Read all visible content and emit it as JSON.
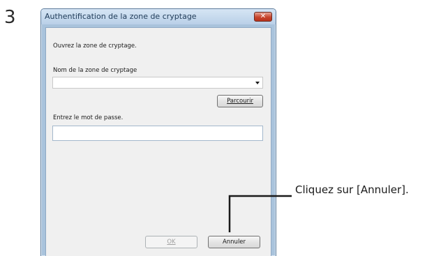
{
  "step": {
    "number": "3"
  },
  "dialog": {
    "title": "Authentification de la zone de cryptage",
    "close_icon": "close-icon",
    "instruction": "Ouvrez la zone de cryptage.",
    "zone_name_label": "Nom de la zone de cryptage",
    "zone_name_value": "",
    "browse_label": "Parcourir",
    "password_label": "Entrez le mot de passe.",
    "password_value": "",
    "ok_label": "OK",
    "cancel_label": "Annuler"
  },
  "callout": {
    "text": "Cliquez sur [Annuler]."
  },
  "colors": {
    "close_button": "#c7452c",
    "frame": "#a9c3dc",
    "client": "#f0f0f0"
  }
}
